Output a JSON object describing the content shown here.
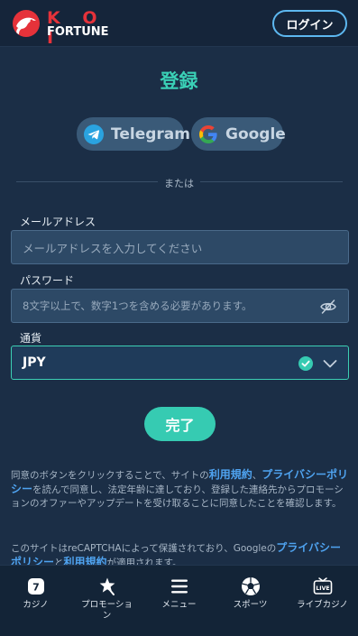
{
  "header": {
    "logo_top": "K O I",
    "logo_bottom": "FORTUNE",
    "login_label": "ログイン"
  },
  "page_title": "登録",
  "social": {
    "telegram_label": "Telegram",
    "google_label": "Google"
  },
  "divider_text": "または",
  "form": {
    "email_label": "メールアドレス",
    "email_placeholder": "メールアドレスを入力してください",
    "password_label": "パスワード",
    "password_placeholder": "8文字以上で、数字1つを含める必要があります。",
    "currency_label": "通貨",
    "currency_value": "JPY",
    "submit_label": "完了"
  },
  "legal": {
    "consent_p1": "同意のボタンをクリックすることで、サイトの",
    "terms_link": "利用規約",
    "consent_p2": "、",
    "privacy_link": "プライバシーポリシー",
    "consent_p3": "を読んで同意し、法定年齢に達しており、登録した連絡先からプロモーションのオファーやアップデートを受け取ることに同意したことを確認します。",
    "recaptcha_p1": "このサイトはreCAPTCHAによって保護されており、Googleの",
    "recaptcha_privacy_link": "プライバシーポリシー",
    "recaptcha_p2": "と",
    "recaptcha_terms_link": "利用規約",
    "recaptcha_p3": "が適用されます。"
  },
  "bottom_nav": [
    {
      "label": "カジノ",
      "icon": "casino-icon"
    },
    {
      "label": "プロモーション",
      "icon": "promotion-icon"
    },
    {
      "label": "メニュー",
      "icon": "menu-icon"
    },
    {
      "label": "スポーツ",
      "icon": "soccer-ball-icon"
    },
    {
      "label": "ライブカジノ",
      "icon": "live-casino-icon"
    }
  ],
  "live_badge": "LIVE",
  "colors": {
    "background": "#1b2e46",
    "accent": "#36cbb2",
    "link": "#4fa3f0",
    "brand_red": "#e5323a"
  }
}
